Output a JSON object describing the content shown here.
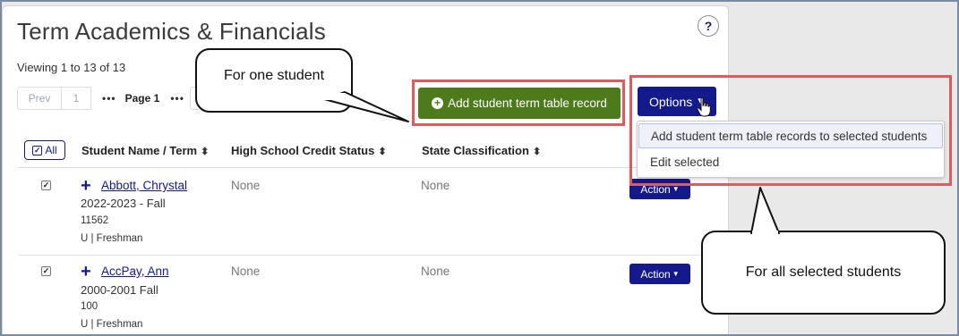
{
  "page": {
    "title": "Term Academics & Financials",
    "help_label": "?",
    "viewing": "Viewing 1 to 13 of 13"
  },
  "pager": {
    "prev_label": "Prev",
    "first_page": "1",
    "ellipsis": "•••",
    "current_page": "Page 1"
  },
  "toolbar": {
    "add_record_label": "Add student term table record",
    "options_label": "Options",
    "options_menu": [
      "Add student term table records to selected students",
      "Edit selected"
    ]
  },
  "table": {
    "select_all_label": "All",
    "columns": [
      "Student Name / Term",
      "High School Credit Status",
      "State Classification"
    ],
    "rows": [
      {
        "name": "Abbott, Chrystal",
        "term": "2022-2023 - Fall",
        "id": "11562",
        "level": "U | Freshman",
        "credit_status": "None",
        "state_classification": "None",
        "action_label": "Action"
      },
      {
        "name": "AccPay, Ann",
        "term": "2000-2001 Fall",
        "id": "100",
        "level": "U | Freshman",
        "credit_status": "None",
        "state_classification": "None",
        "action_label": "Action"
      }
    ]
  },
  "callouts": {
    "one_student": "For one student",
    "all_selected": "For all selected students"
  },
  "colors": {
    "primary_navy": "#141a8c",
    "add_button_green": "#4d7a1b",
    "highlight_red": "#e05b5b"
  }
}
